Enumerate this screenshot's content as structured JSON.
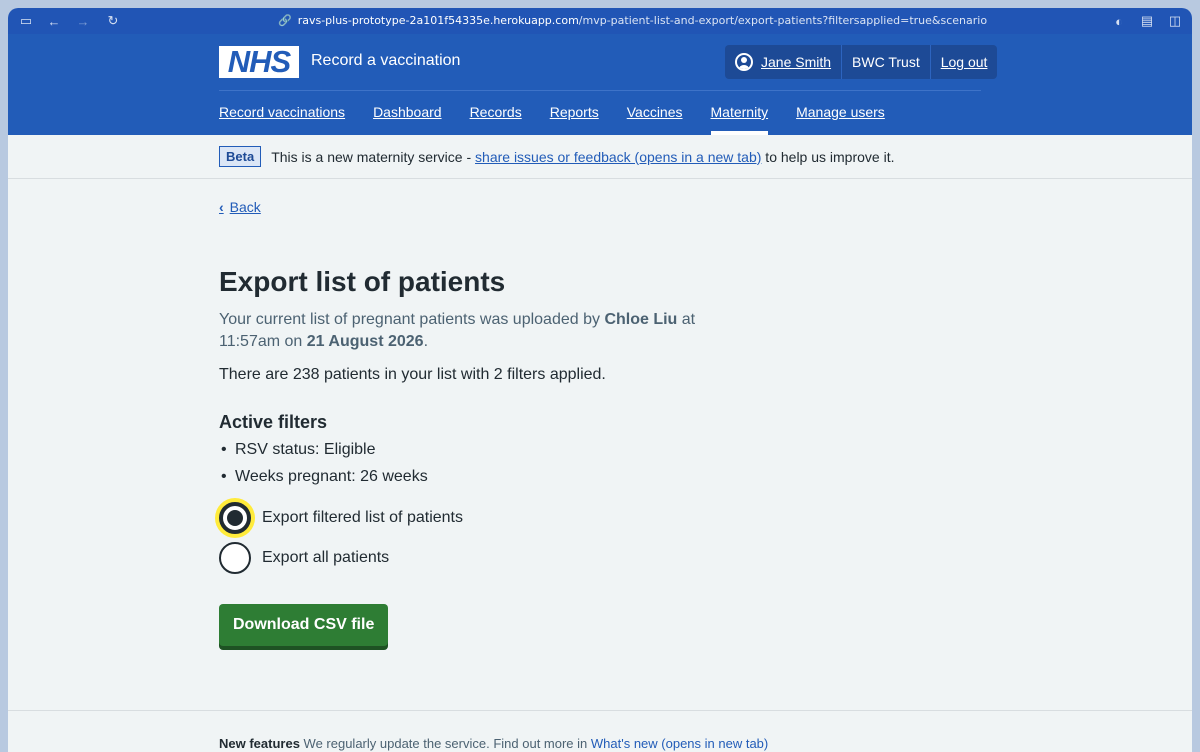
{
  "browser": {
    "url_host": "ravs-plus-prototype-2a101f54335e.herokuapp.com",
    "url_path": "/mvp-patient-list-and-export/export-patients?filtersapplied=true&scenario"
  },
  "header": {
    "logo_text": "NHS",
    "service_name": "Record a vaccination",
    "user_name": "Jane Smith",
    "organisation": "BWC Trust",
    "logout_label": "Log out"
  },
  "nav": {
    "items": [
      {
        "label": "Record vaccinations"
      },
      {
        "label": "Dashboard"
      },
      {
        "label": "Records"
      },
      {
        "label": "Reports"
      },
      {
        "label": "Vaccines"
      },
      {
        "label": "Maternity"
      },
      {
        "label": "Manage users"
      }
    ],
    "active": "Maternity"
  },
  "phase_banner": {
    "tag": "Beta",
    "text_before": "This is a new maternity service - ",
    "link_text": "share issues or feedback (opens in a new tab)",
    "text_after": " to help us improve it."
  },
  "main": {
    "back_label": "Back",
    "title": "Export list of patients",
    "lede_1": "Your current list of pregnant patients was uploaded by ",
    "uploader": "Chloe Liu",
    "lede_2": " at 11:57am on ",
    "upload_date": "21 August 2026",
    "lede_3": ".",
    "count_text": "There are 238 patients in your list with 2 filters applied.",
    "filters_heading": "Active filters",
    "filters": [
      {
        "text": "RSV status: Eligible"
      },
      {
        "text": "Weeks pregnant: 26 weeks"
      }
    ],
    "options": [
      {
        "label": "Export filtered list of patients",
        "checked": true
      },
      {
        "label": "Export all patients",
        "checked": false
      }
    ],
    "download_label": "Download CSV file"
  },
  "footer": {
    "peek_bold": "New features",
    "peek_text": " We regularly update the service. Find out more in ",
    "peek_link": "What's new (opens in new tab)"
  }
}
